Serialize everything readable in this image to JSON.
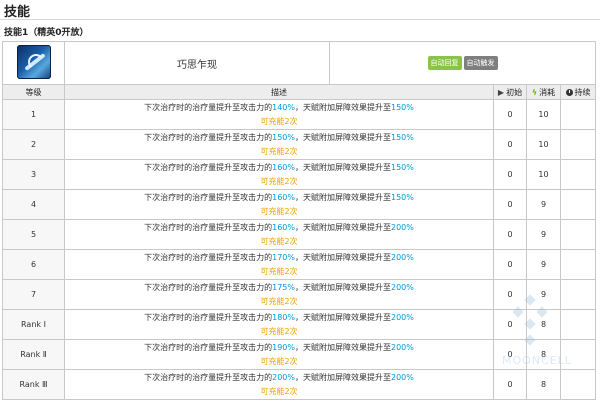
{
  "page": {
    "section_title": "技能",
    "skill_subtitle": "技能1（精英0开放）"
  },
  "skill": {
    "name": "巧思乍现",
    "icon": "skill-icon",
    "tags": [
      {
        "label": "自动回复",
        "color": "#8bc34a"
      },
      {
        "label": "自动触发",
        "color": "#7f7f7f"
      }
    ]
  },
  "headers": {
    "level": "等级",
    "description": "描述",
    "initial": "初始",
    "cost": "消耗",
    "duration": "持续",
    "initial_icon": "play-icon",
    "cost_icon": "bolt-icon",
    "duration_icon": "clock-icon"
  },
  "desc_parts": {
    "p1": "下次治疗时的治疗量提升至攻击力的",
    "p2": "，天赋附加屏障效果提升至",
    "charges": "可充能2次"
  },
  "levels": [
    {
      "level": "1",
      "heal": "140%",
      "barrier": "150%",
      "initial": "0",
      "cost": "10",
      "duration": ""
    },
    {
      "level": "2",
      "heal": "150%",
      "barrier": "150%",
      "initial": "0",
      "cost": "10",
      "duration": ""
    },
    {
      "level": "3",
      "heal": "160%",
      "barrier": "150%",
      "initial": "0",
      "cost": "10",
      "duration": ""
    },
    {
      "level": "4",
      "heal": "160%",
      "barrier": "150%",
      "initial": "0",
      "cost": "9",
      "duration": ""
    },
    {
      "level": "5",
      "heal": "160%",
      "barrier": "200%",
      "initial": "0",
      "cost": "9",
      "duration": ""
    },
    {
      "level": "6",
      "heal": "170%",
      "barrier": "200%",
      "initial": "0",
      "cost": "9",
      "duration": ""
    },
    {
      "level": "7",
      "heal": "175%",
      "barrier": "200%",
      "initial": "0",
      "cost": "9",
      "duration": ""
    },
    {
      "level": "Rank Ⅰ",
      "heal": "180%",
      "barrier": "200%",
      "initial": "0",
      "cost": "8",
      "duration": ""
    },
    {
      "level": "Rank Ⅱ",
      "heal": "190%",
      "barrier": "200%",
      "initial": "0",
      "cost": "8",
      "duration": ""
    },
    {
      "level": "Rank Ⅲ",
      "heal": "200%",
      "barrier": "200%",
      "initial": "0",
      "cost": "8",
      "duration": ""
    }
  ],
  "colors": {
    "value_blue": "#0098dc",
    "charge_orange": "#f6a000",
    "header_bg": "#ededed"
  },
  "watermark": {
    "text": "MOONCELL"
  }
}
